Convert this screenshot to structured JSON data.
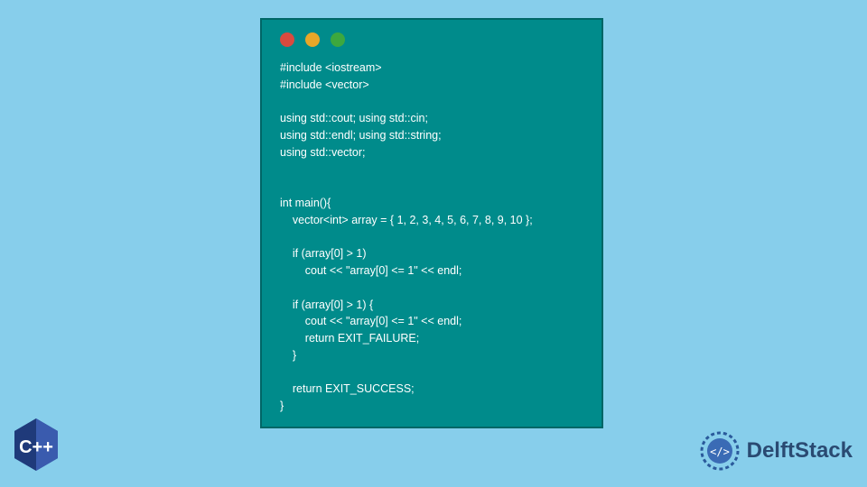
{
  "code": {
    "line1": "#include <iostream>",
    "line2": "#include <vector>",
    "line3": "using std::cout; using std::cin;",
    "line4": "using std::endl; using std::string;",
    "line5": "using std::vector;",
    "line6": "int main(){",
    "line7": "    vector<int> array = { 1, 2, 3, 4, 5, 6, 7, 8, 9, 10 };",
    "line8": "    if (array[0] > 1)",
    "line9": "        cout << \"array[0] <= 1\" << endl;",
    "line10": "    if (array[0] > 1) {",
    "line11": "        cout << \"array[0] <= 1\" << endl;",
    "line12": "        return EXIT_FAILURE;",
    "line13": "    }",
    "line14": "    return EXIT_SUCCESS;",
    "line15": "}"
  },
  "logos": {
    "cpp": "C++",
    "delft": "DelftStack"
  }
}
